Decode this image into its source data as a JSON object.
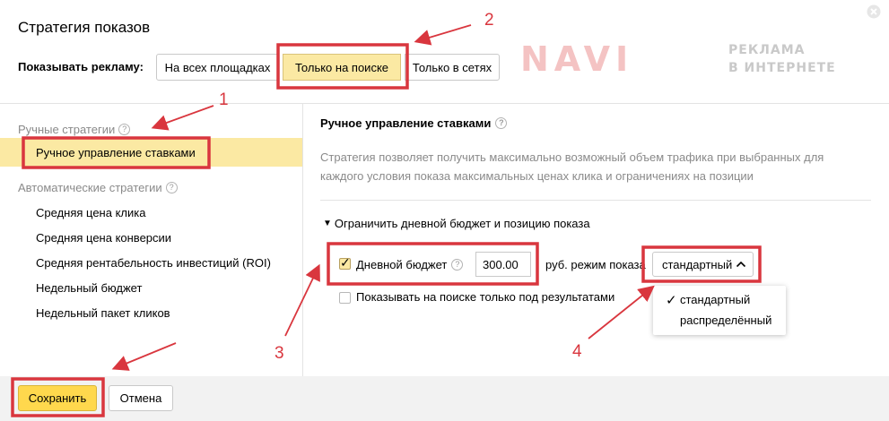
{
  "dialog": {
    "title": "Стратегия показов",
    "close_icon": "close-icon"
  },
  "show_ads": {
    "label": "Показывать рекламу:",
    "options": [
      "На всех площадках",
      "Только на поиске",
      "Только в сетях"
    ],
    "selected": "Только на поиске"
  },
  "watermark": {
    "brand": "NAVI",
    "line1": "РЕКЛАМА",
    "line2": "В ИНТЕРНЕТЕ"
  },
  "sidebar": {
    "manual_group": "Ручные стратегии",
    "manual_items": [
      "Ручное управление ставками"
    ],
    "auto_group": "Автоматические стратегии",
    "auto_items": [
      "Средняя цена клика",
      "Средняя цена конверсии",
      "Средняя рентабельность инвестиций (ROI)",
      "Недельный бюджет",
      "Недельный пакет кликов"
    ],
    "help_icon": "question-icon"
  },
  "main": {
    "title": "Ручное управление ставками",
    "description": "Стратегия позволяет получить максимально возможный объем трафика при выбранных для каждого условия показа максимальных ценах клика и ограничениях на позиции",
    "limit_toggle": "Ограничить дневной бюджет и позицию показа",
    "daily_budget": {
      "label": "Дневной бюджет",
      "checked": true,
      "value": "300.00",
      "currency_mode": "руб. режим показа"
    },
    "mode_select": {
      "value": "стандартный",
      "options": [
        "стандартный",
        "распределённый"
      ]
    },
    "below_results": {
      "label": "Показывать на поиске только под результатами",
      "checked": false
    }
  },
  "footer": {
    "save": "Сохранить",
    "cancel": "Отмена"
  },
  "annotations": {
    "color": "#d9363e",
    "numbers": [
      "1",
      "2",
      "3",
      "4"
    ]
  }
}
